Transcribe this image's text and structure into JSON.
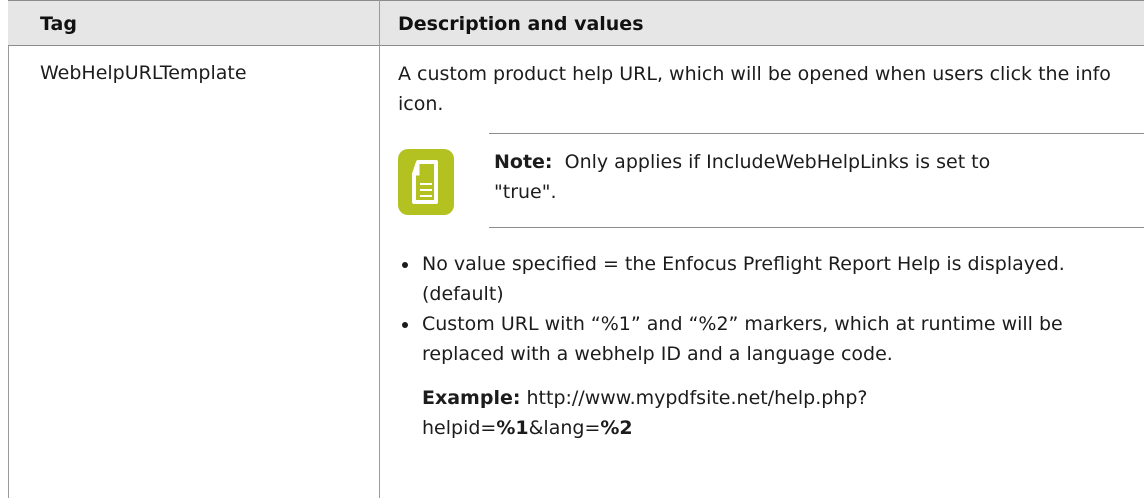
{
  "table": {
    "headers": {
      "tag": "Tag",
      "description": "Description and values"
    },
    "row": {
      "tag": "WebHelpURLTemplate",
      "intro": "A custom product help URL, which will be opened when users click the info icon.",
      "note": {
        "label": "Note:",
        "text": "Only applies if IncludeWebHelpLinks is set to \"true\".",
        "icon": "note-document-icon",
        "icon_color": "#b3c220"
      },
      "bullets": [
        "No value specified = the Enfocus Preflight Report Help is displayed. (default)",
        "Custom URL with “%1” and “%2” markers, which at runtime will be replaced with a webhelp ID and a language code."
      ],
      "example": {
        "label": "Example:",
        "url_part1": "http://www.mypdfsite.net/help.php?",
        "url_part2_prefix": "helpid=",
        "marker1": "%1",
        "url_part2_mid": "&lang=",
        "marker2": "%2"
      }
    }
  }
}
